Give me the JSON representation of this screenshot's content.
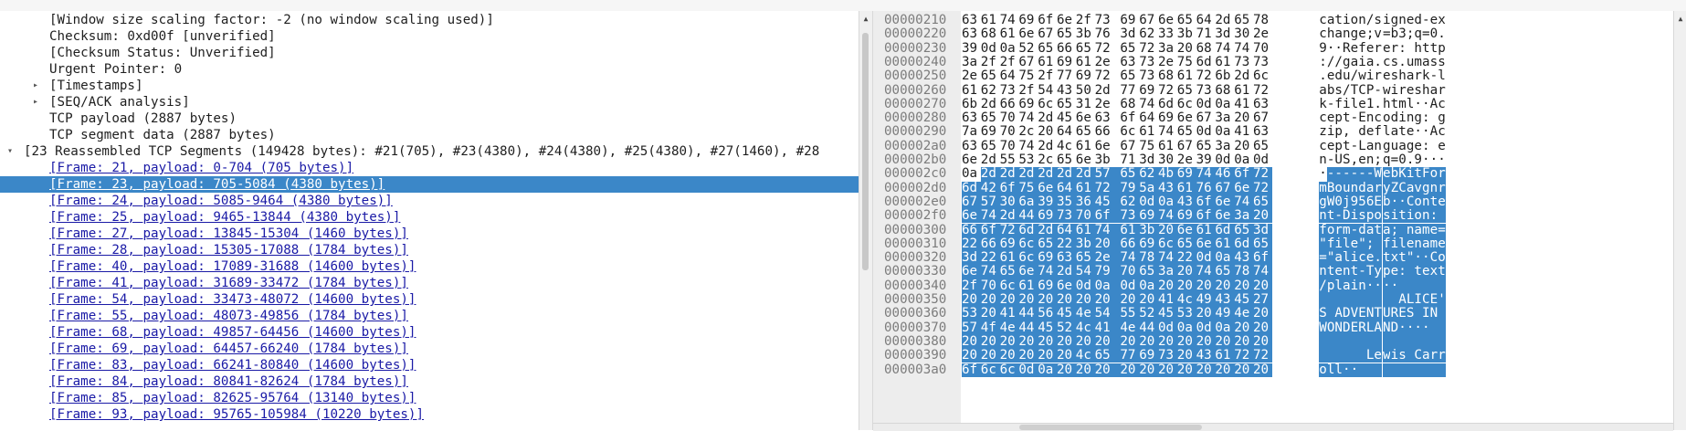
{
  "tree": {
    "rows": [
      {
        "text": "[Window size scaling factor: -2 (no window scaling used)]",
        "indent": 3,
        "arrow": "",
        "link": false,
        "selected": false
      },
      {
        "text": "Checksum: 0xd00f [unverified]",
        "indent": 3,
        "arrow": "",
        "link": false,
        "selected": false
      },
      {
        "text": "[Checksum Status: Unverified]",
        "indent": 3,
        "arrow": "",
        "link": false,
        "selected": false
      },
      {
        "text": "Urgent Pointer: 0",
        "indent": 3,
        "arrow": "",
        "link": false,
        "selected": false
      },
      {
        "text": "[Timestamps]",
        "indent": 3,
        "arrow": "▸",
        "link": false,
        "selected": false
      },
      {
        "text": "[SEQ/ACK analysis]",
        "indent": 3,
        "arrow": "▸",
        "link": false,
        "selected": false
      },
      {
        "text": "TCP payload (2887 bytes)",
        "indent": 3,
        "arrow": "",
        "link": false,
        "selected": false
      },
      {
        "text": "TCP segment data (2887 bytes)",
        "indent": 3,
        "arrow": "",
        "link": false,
        "selected": false
      },
      {
        "text": "[23 Reassembled TCP Segments (149428 bytes): #21(705), #23(4380), #24(4380), #25(4380), #27(1460), #28",
        "indent": 1,
        "arrow": "▾",
        "link": false,
        "selected": false
      },
      {
        "text": "[Frame: 21, payload: 0-704 (705 bytes)]",
        "indent": 3,
        "arrow": "",
        "link": true,
        "selected": false
      },
      {
        "text": "[Frame: 23, payload: 705-5084 (4380 bytes)]",
        "indent": 3,
        "arrow": "",
        "link": true,
        "selected": true
      },
      {
        "text": "[Frame: 24, payload: 5085-9464 (4380 bytes)]",
        "indent": 3,
        "arrow": "",
        "link": true,
        "selected": false
      },
      {
        "text": "[Frame: 25, payload: 9465-13844 (4380 bytes)]",
        "indent": 3,
        "arrow": "",
        "link": true,
        "selected": false
      },
      {
        "text": "[Frame: 27, payload: 13845-15304 (1460 bytes)]",
        "indent": 3,
        "arrow": "",
        "link": true,
        "selected": false
      },
      {
        "text": "[Frame: 28, payload: 15305-17088 (1784 bytes)]",
        "indent": 3,
        "arrow": "",
        "link": true,
        "selected": false
      },
      {
        "text": "[Frame: 40, payload: 17089-31688 (14600 bytes)]",
        "indent": 3,
        "arrow": "",
        "link": true,
        "selected": false
      },
      {
        "text": "[Frame: 41, payload: 31689-33472 (1784 bytes)]",
        "indent": 3,
        "arrow": "",
        "link": true,
        "selected": false
      },
      {
        "text": "[Frame: 54, payload: 33473-48072 (14600 bytes)]",
        "indent": 3,
        "arrow": "",
        "link": true,
        "selected": false
      },
      {
        "text": "[Frame: 55, payload: 48073-49856 (1784 bytes)]",
        "indent": 3,
        "arrow": "",
        "link": true,
        "selected": false
      },
      {
        "text": "[Frame: 68, payload: 49857-64456 (14600 bytes)]",
        "indent": 3,
        "arrow": "",
        "link": true,
        "selected": false
      },
      {
        "text": "[Frame: 69, payload: 64457-66240 (1784 bytes)]",
        "indent": 3,
        "arrow": "",
        "link": true,
        "selected": false
      },
      {
        "text": "[Frame: 83, payload: 66241-80840 (14600 bytes)]",
        "indent": 3,
        "arrow": "",
        "link": true,
        "selected": false
      },
      {
        "text": "[Frame: 84, payload: 80841-82624 (1784 bytes)]",
        "indent": 3,
        "arrow": "",
        "link": true,
        "selected": false
      },
      {
        "text": "[Frame: 85, payload: 82625-95764 (13140 bytes)]",
        "indent": 3,
        "arrow": "",
        "link": true,
        "selected": false
      },
      {
        "text": "[Frame: 93, payload: 95765-105984 (10220 bytes)]",
        "indent": 3,
        "arrow": "",
        "link": true,
        "selected": false
      }
    ]
  },
  "hex": {
    "rows": [
      {
        "offset": "00000210",
        "bytes": [
          "63",
          "61",
          "74",
          "69",
          "6f",
          "6e",
          "2f",
          "73",
          "69",
          "67",
          "6e",
          "65",
          "64",
          "2d",
          "65",
          "78"
        ],
        "ascii": "cation/signed-ex",
        "hl_from": 16
      },
      {
        "offset": "00000220",
        "bytes": [
          "63",
          "68",
          "61",
          "6e",
          "67",
          "65",
          "3b",
          "76",
          "3d",
          "62",
          "33",
          "3b",
          "71",
          "3d",
          "30",
          "2e"
        ],
        "ascii": "change;v=b3;q=0.",
        "hl_from": 16
      },
      {
        "offset": "00000230",
        "bytes": [
          "39",
          "0d",
          "0a",
          "52",
          "65",
          "66",
          "65",
          "72",
          "65",
          "72",
          "3a",
          "20",
          "68",
          "74",
          "74",
          "70"
        ],
        "ascii": "9··Referer: http",
        "hl_from": 16
      },
      {
        "offset": "00000240",
        "bytes": [
          "3a",
          "2f",
          "2f",
          "67",
          "61",
          "69",
          "61",
          "2e",
          "63",
          "73",
          "2e",
          "75",
          "6d",
          "61",
          "73",
          "73"
        ],
        "ascii": "://gaia.cs.umass",
        "hl_from": 16
      },
      {
        "offset": "00000250",
        "bytes": [
          "2e",
          "65",
          "64",
          "75",
          "2f",
          "77",
          "69",
          "72",
          "65",
          "73",
          "68",
          "61",
          "72",
          "6b",
          "2d",
          "6c"
        ],
        "ascii": ".edu/wireshark-l",
        "hl_from": 16
      },
      {
        "offset": "00000260",
        "bytes": [
          "61",
          "62",
          "73",
          "2f",
          "54",
          "43",
          "50",
          "2d",
          "77",
          "69",
          "72",
          "65",
          "73",
          "68",
          "61",
          "72"
        ],
        "ascii": "abs/TCP-wireshar",
        "hl_from": 16
      },
      {
        "offset": "00000270",
        "bytes": [
          "6b",
          "2d",
          "66",
          "69",
          "6c",
          "65",
          "31",
          "2e",
          "68",
          "74",
          "6d",
          "6c",
          "0d",
          "0a",
          "41",
          "63"
        ],
        "ascii": "k-file1.html··Ac",
        "hl_from": 16
      },
      {
        "offset": "00000280",
        "bytes": [
          "63",
          "65",
          "70",
          "74",
          "2d",
          "45",
          "6e",
          "63",
          "6f",
          "64",
          "69",
          "6e",
          "67",
          "3a",
          "20",
          "67"
        ],
        "ascii": "cept-Encoding: g",
        "hl_from": 16
      },
      {
        "offset": "00000290",
        "bytes": [
          "7a",
          "69",
          "70",
          "2c",
          "20",
          "64",
          "65",
          "66",
          "6c",
          "61",
          "74",
          "65",
          "0d",
          "0a",
          "41",
          "63"
        ],
        "ascii": "zip, deflate··Ac",
        "hl_from": 16
      },
      {
        "offset": "000002a0",
        "bytes": [
          "63",
          "65",
          "70",
          "74",
          "2d",
          "4c",
          "61",
          "6e",
          "67",
          "75",
          "61",
          "67",
          "65",
          "3a",
          "20",
          "65"
        ],
        "ascii": "cept-Language: e",
        "hl_from": 16
      },
      {
        "offset": "000002b0",
        "bytes": [
          "6e",
          "2d",
          "55",
          "53",
          "2c",
          "65",
          "6e",
          "3b",
          "71",
          "3d",
          "30",
          "2e",
          "39",
          "0d",
          "0a",
          "0d"
        ],
        "ascii": "n-US,en;q=0.9···",
        "hl_from": 16
      },
      {
        "offset": "000002c0",
        "bytes": [
          "0a",
          "2d",
          "2d",
          "2d",
          "2d",
          "2d",
          "2d",
          "57",
          "65",
          "62",
          "4b",
          "69",
          "74",
          "46",
          "6f",
          "72"
        ],
        "ascii": "·------WebKitFor",
        "hl_from": 1
      },
      {
        "offset": "000002d0",
        "bytes": [
          "6d",
          "42",
          "6f",
          "75",
          "6e",
          "64",
          "61",
          "72",
          "79",
          "5a",
          "43",
          "61",
          "76",
          "67",
          "6e",
          "72"
        ],
        "ascii": "mBoundaryZCavgnr",
        "hl_from": 0
      },
      {
        "offset": "000002e0",
        "bytes": [
          "67",
          "57",
          "30",
          "6a",
          "39",
          "35",
          "36",
          "45",
          "62",
          "0d",
          "0a",
          "43",
          "6f",
          "6e",
          "74",
          "65"
        ],
        "ascii": "gW0j956Eb··Conte",
        "hl_from": 0
      },
      {
        "offset": "000002f0",
        "bytes": [
          "6e",
          "74",
          "2d",
          "44",
          "69",
          "73",
          "70",
          "6f",
          "73",
          "69",
          "74",
          "69",
          "6f",
          "6e",
          "3a",
          "20"
        ],
        "ascii": "nt-Disposition: ",
        "hl_from": 0
      },
      {
        "offset": "00000300",
        "bytes": [
          "66",
          "6f",
          "72",
          "6d",
          "2d",
          "64",
          "61",
          "74",
          "61",
          "3b",
          "20",
          "6e",
          "61",
          "6d",
          "65",
          "3d"
        ],
        "ascii": "form-data; name=",
        "hl_from": 0
      },
      {
        "offset": "00000310",
        "bytes": [
          "22",
          "66",
          "69",
          "6c",
          "65",
          "22",
          "3b",
          "20",
          "66",
          "69",
          "6c",
          "65",
          "6e",
          "61",
          "6d",
          "65"
        ],
        "ascii": "\"file\"; filename",
        "hl_from": 0
      },
      {
        "offset": "00000320",
        "bytes": [
          "3d",
          "22",
          "61",
          "6c",
          "69",
          "63",
          "65",
          "2e",
          "74",
          "78",
          "74",
          "22",
          "0d",
          "0a",
          "43",
          "6f"
        ],
        "ascii": "=\"alice.txt\"··Co",
        "hl_from": 0
      },
      {
        "offset": "00000330",
        "bytes": [
          "6e",
          "74",
          "65",
          "6e",
          "74",
          "2d",
          "54",
          "79",
          "70",
          "65",
          "3a",
          "20",
          "74",
          "65",
          "78",
          "74"
        ],
        "ascii": "ntent-Type: text",
        "hl_from": 0
      },
      {
        "offset": "00000340",
        "bytes": [
          "2f",
          "70",
          "6c",
          "61",
          "69",
          "6e",
          "0d",
          "0a",
          "0d",
          "0a",
          "20",
          "20",
          "20",
          "20",
          "20",
          "20"
        ],
        "ascii": "/plain····      ",
        "hl_from": 0
      },
      {
        "offset": "00000350",
        "bytes": [
          "20",
          "20",
          "20",
          "20",
          "20",
          "20",
          "20",
          "20",
          "20",
          "20",
          "41",
          "4c",
          "49",
          "43",
          "45",
          "27"
        ],
        "ascii": "          ALICE'",
        "hl_from": 0
      },
      {
        "offset": "00000360",
        "bytes": [
          "53",
          "20",
          "41",
          "44",
          "56",
          "45",
          "4e",
          "54",
          "55",
          "52",
          "45",
          "53",
          "20",
          "49",
          "4e",
          "20"
        ],
        "ascii": "S ADVENTURES IN ",
        "hl_from": 0
      },
      {
        "offset": "00000370",
        "bytes": [
          "57",
          "4f",
          "4e",
          "44",
          "45",
          "52",
          "4c",
          "41",
          "4e",
          "44",
          "0d",
          "0a",
          "0d",
          "0a",
          "20",
          "20"
        ],
        "ascii": "WONDERLAND····  ",
        "hl_from": 0
      },
      {
        "offset": "00000380",
        "bytes": [
          "20",
          "20",
          "20",
          "20",
          "20",
          "20",
          "20",
          "20",
          "20",
          "20",
          "20",
          "20",
          "20",
          "20",
          "20",
          "20"
        ],
        "ascii": "                ",
        "hl_from": 0
      },
      {
        "offset": "00000390",
        "bytes": [
          "20",
          "20",
          "20",
          "20",
          "20",
          "20",
          "4c",
          "65",
          "77",
          "69",
          "73",
          "20",
          "43",
          "61",
          "72",
          "72"
        ],
        "ascii": "      Lewis Carr",
        "hl_from": 0
      },
      {
        "offset": "000003a0",
        "bytes": [
          "6f",
          "6c",
          "6c",
          "0d",
          "0a",
          "20",
          "20",
          "20",
          "20",
          "20",
          "20",
          "20",
          "20",
          "20",
          "20",
          "20"
        ],
        "ascii": "oll··           ",
        "hl_from": 0
      }
    ]
  },
  "colors": {
    "selection": "#3b87c8",
    "link": "#1a1aa6",
    "offset_bg": "#ededed"
  }
}
